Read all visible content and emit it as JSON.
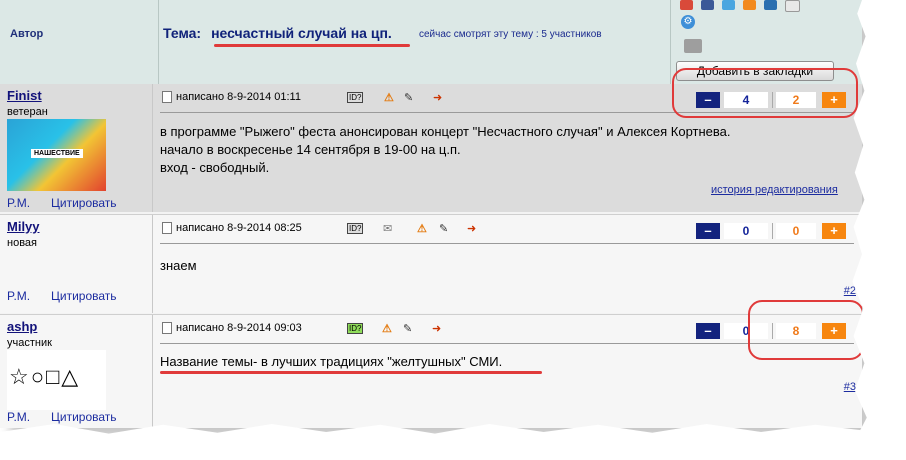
{
  "header": {
    "author_label": "Автор",
    "topic_label": "Тема:",
    "topic_title": "несчастный случай на цп.",
    "watching": "сейчас смотрят эту тему : 5 участников",
    "bookmark_button": "Добавить в закладки"
  },
  "posts": [
    {
      "author": "Finist",
      "rank": "ветеран",
      "meta": "написано 8-9-2014 01:11",
      "body": [
        "в программе \"Рыжего\" феста анонсирован концерт \"Несчастного случая\" и Алексея Кортнева.",
        "начало в воскресенье 14 сентября в 19-00 на ц.п.",
        "вход - свободный."
      ],
      "rating_pos": "4",
      "rating_neg": "2",
      "history_link": "история редактирования",
      "avatar_text": "НАШЕСТВИЕ",
      "anchor": ""
    },
    {
      "author": "Milyy",
      "rank": "новая",
      "meta": "написано 8-9-2014 08:25",
      "body": [
        "знаем"
      ],
      "rating_pos": "0",
      "rating_neg": "0",
      "anchor": "#2"
    },
    {
      "author": "ashp",
      "rank": "участник",
      "meta": "написано 8-9-2014 09:03",
      "body": [
        "Название темы- в лучших традициях \"желтушных\" СМИ."
      ],
      "rating_pos": "0",
      "rating_neg": "8",
      "avatar_symbols": "☆○□△",
      "anchor": "#3"
    }
  ],
  "actions": {
    "pm": "P.M.",
    "quote": "Цитировать",
    "minus": "–",
    "plus": "+"
  },
  "colors": {
    "header_bg": "#dce8e6",
    "rating_minus": "#13237e",
    "rating_plus": "#f7860f",
    "annotation_red": "#e03a3a"
  }
}
